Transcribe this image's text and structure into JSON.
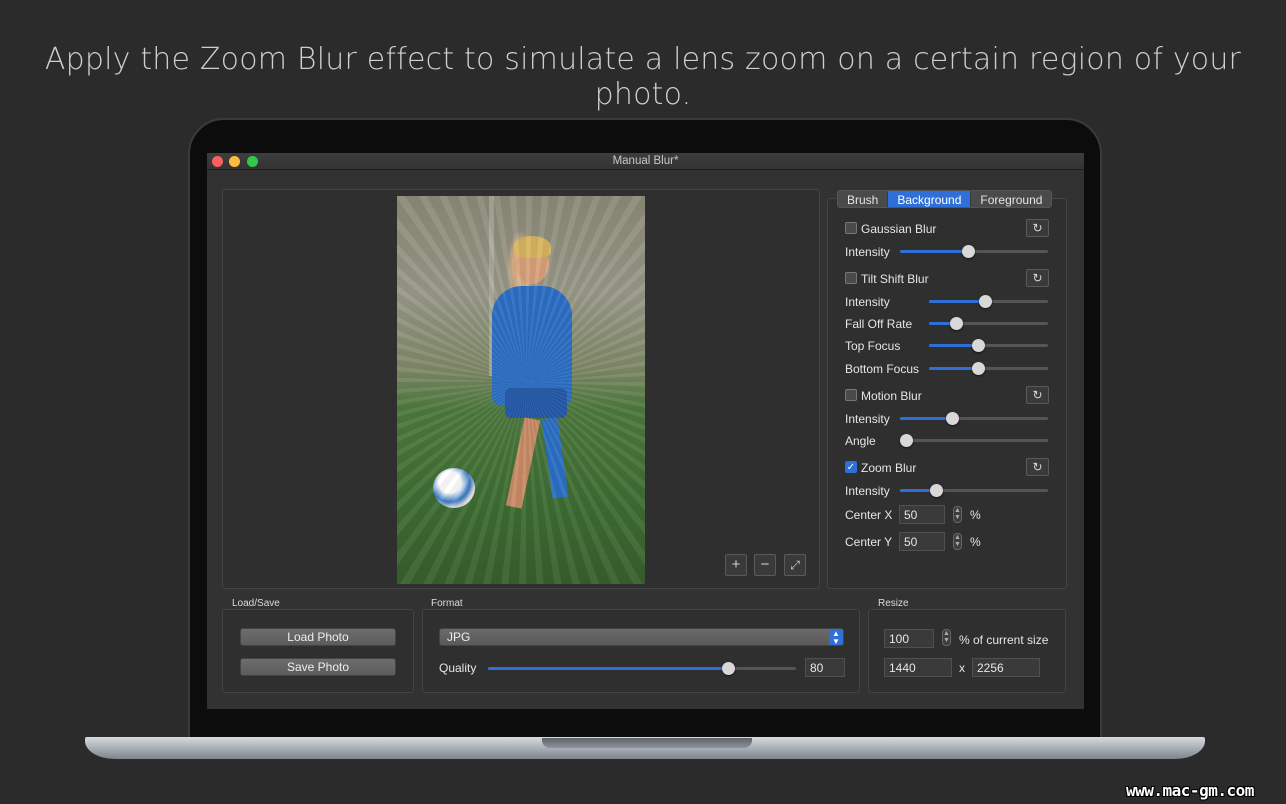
{
  "headline": "Apply the Zoom Blur effect to simulate a lens zoom on a certain region of your photo.",
  "window": {
    "title": "Manual Blur*"
  },
  "tabs": [
    {
      "label": "Brush",
      "active": false
    },
    {
      "label": "Background",
      "active": true
    },
    {
      "label": "Foreground",
      "active": false
    }
  ],
  "gaussian": {
    "label": "Gaussian Blur",
    "checked": false,
    "intensity_label": "Intensity",
    "intensity": 0.46
  },
  "tilt": {
    "label": "Tilt Shift Blur",
    "checked": false,
    "intensity_label": "Intensity",
    "intensity": 0.47,
    "falloff_label": "Fall Off Rate",
    "falloff": 0.23,
    "top_label": "Top Focus",
    "top": 0.41,
    "bottom_label": "Bottom Focus",
    "bottom": 0.41
  },
  "motion": {
    "label": "Motion Blur",
    "checked": false,
    "intensity_label": "Intensity",
    "intensity": 0.35,
    "angle_label": "Angle",
    "angle": 0.04
  },
  "zoom": {
    "label": "Zoom Blur",
    "checked": true,
    "intensity_label": "Intensity",
    "intensity": 0.24,
    "center_x_label": "Center X",
    "center_x": "50",
    "center_x_unit": "%",
    "center_y_label": "Center Y",
    "center_y": "50",
    "center_y_unit": "%"
  },
  "reset_icon": "↻",
  "zoom_controls": {
    "plus": "+",
    "minus": "−",
    "fit": "⤢"
  },
  "loadsave": {
    "label": "Load/Save",
    "load": "Load Photo",
    "save": "Save Photo"
  },
  "format": {
    "label": "Format",
    "selected": "JPG",
    "quality_label": "Quality",
    "quality": "80",
    "quality_level": 0.78
  },
  "resize": {
    "label": "Resize",
    "percent": "100",
    "percent_label": "% of current size",
    "width": "1440",
    "x": "x",
    "height": "2256"
  },
  "watermark": "www.mac-gm.com",
  "colors": {
    "accent": "#2f6fd8",
    "background": "#2b2b2b",
    "window": "#323232"
  }
}
